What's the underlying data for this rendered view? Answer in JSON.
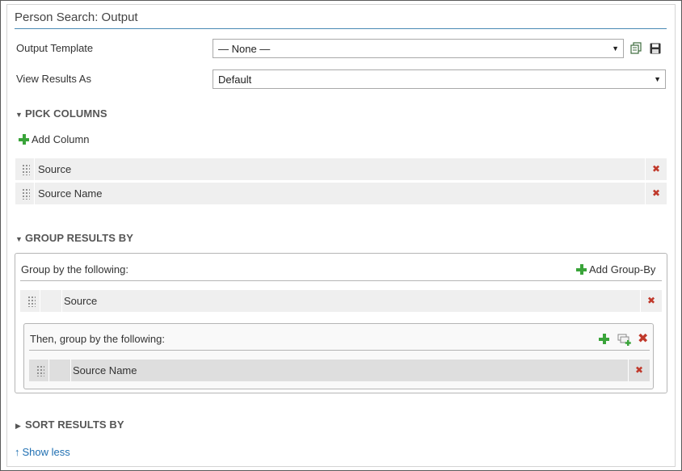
{
  "panel": {
    "title": "Person Search: Output"
  },
  "fields": {
    "output_template": {
      "label": "Output Template",
      "value": "— None —"
    },
    "view_results_as": {
      "label": "View Results As",
      "value": "Default"
    }
  },
  "pick_columns": {
    "heading": "PICK COLUMNS",
    "add_label": "Add Column",
    "columns": [
      {
        "label": "Source"
      },
      {
        "label": "Source Name"
      }
    ]
  },
  "group_results": {
    "heading": "GROUP RESULTS BY",
    "group_by_label": "Group by the following:",
    "add_group_by_label": "Add Group-By",
    "first_group": {
      "label": "Source"
    },
    "then_label": "Then, group by the following:",
    "second_group": {
      "label": "Source Name"
    }
  },
  "sort_results": {
    "heading": "SORT RESULTS BY"
  },
  "footer": {
    "show_less_label": "Show less"
  },
  "colors": {
    "accent_rule": "#4a8ab5",
    "add_green": "#3aa43a",
    "remove_red": "#c0392b",
    "link_blue": "#1f6fb2"
  },
  "icons": {
    "copy": "copy-icon",
    "save": "save-icon",
    "plus": "plus-icon",
    "remove": "remove-icon",
    "drag": "drag-handle-icon",
    "add_subgroup": "add-subgroup-icon",
    "collapse": "triangle-down-icon",
    "expand": "triangle-right-icon",
    "arrow_up": "arrow-up-icon"
  }
}
